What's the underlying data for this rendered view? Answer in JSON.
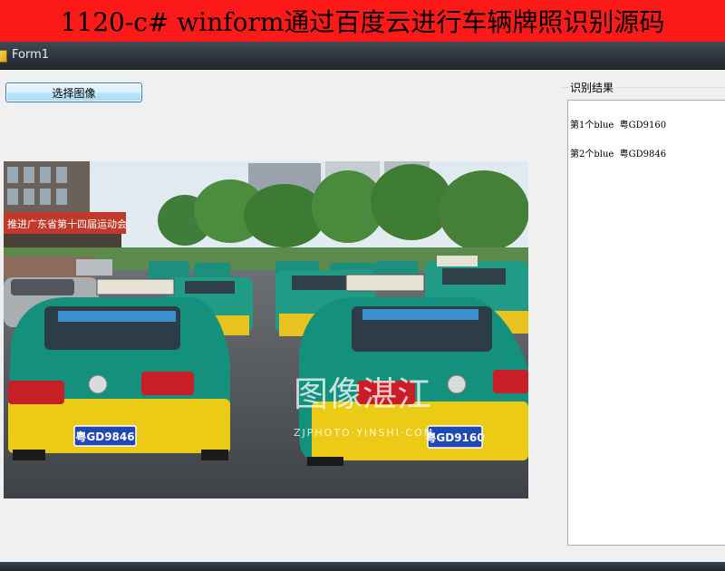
{
  "banner": {
    "title": "1120-c# winform通过百度云进行车辆牌照识别源码"
  },
  "window": {
    "title": "Form1"
  },
  "toolbar": {
    "select_image_label": "选择图像"
  },
  "results": {
    "group_label": "识别结果",
    "lines": [
      "第1个blue  粤GD9160",
      "第2个blue  粤GD9846"
    ]
  },
  "photo": {
    "left_banner_text": "推进广东省第十四届运动会",
    "plate_left": "粤GD9846",
    "plate_right": "粤GD9160",
    "watermark_cn": "图像湛江",
    "watermark_en": "ZJPHOTO·YINSHI·COM"
  }
}
